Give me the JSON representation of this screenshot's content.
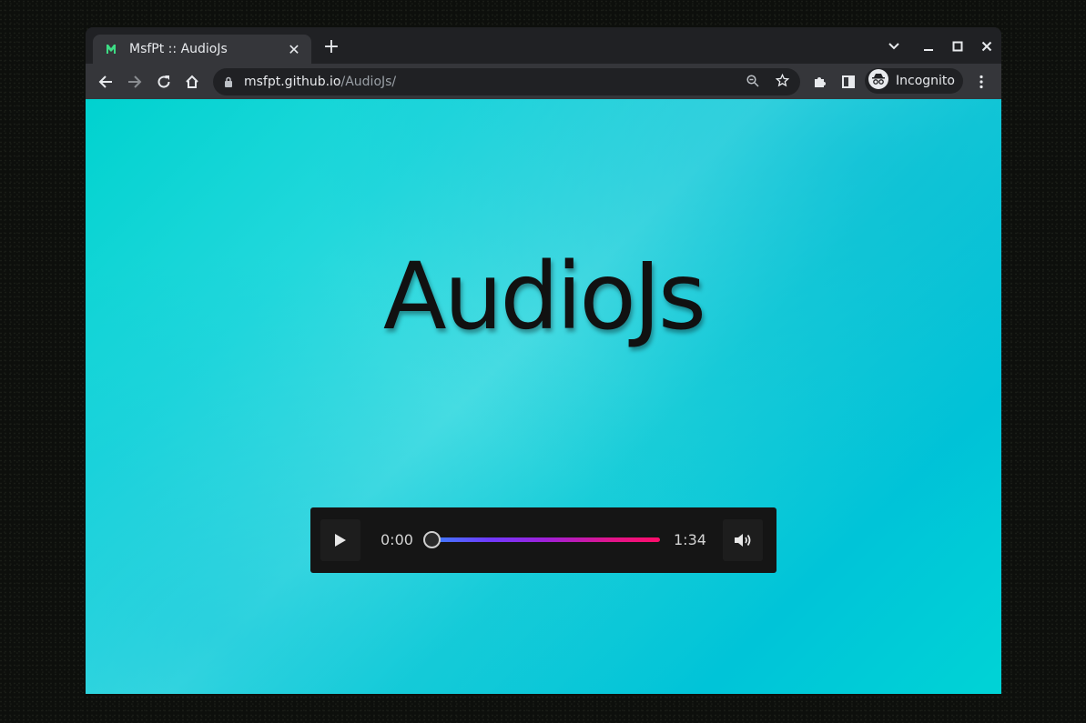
{
  "browser": {
    "tab": {
      "title": "MsfPt :: AudioJs",
      "close_label": "✕"
    },
    "new_tab_label": "+",
    "window_controls": {
      "dropdown": "⌄",
      "minimize": "–",
      "maximize": "☐",
      "close": "✕"
    },
    "address": {
      "host": "msfpt.github.io",
      "path": "/AudioJs/"
    },
    "profile": {
      "label": "Incognito"
    }
  },
  "page": {
    "heading": "AudioJs",
    "player": {
      "current_time": "0:00",
      "duration": "1:34",
      "progress": 0
    }
  },
  "colors": {
    "background_accent": "#00d2d4",
    "track_start": "#3d7fff",
    "track_end": "#ff0d6a",
    "player_bg": "#151515"
  }
}
